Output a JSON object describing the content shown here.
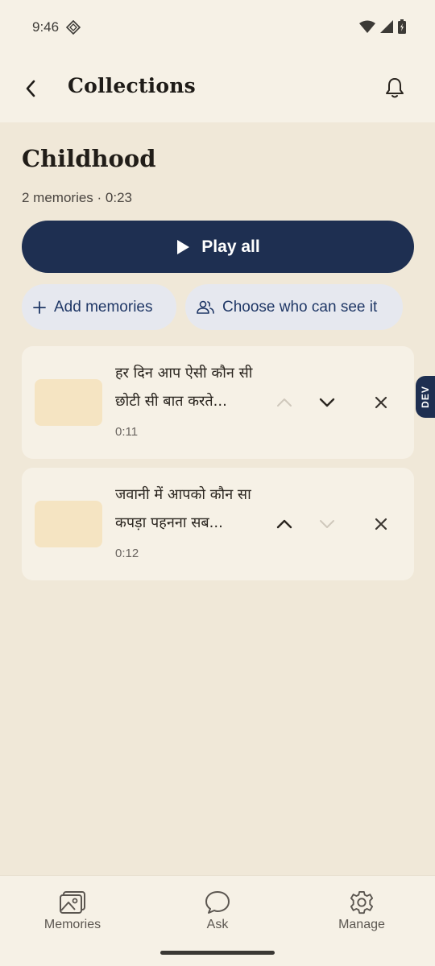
{
  "status_bar": {
    "time": "9:46"
  },
  "app_bar": {
    "title": "Collections"
  },
  "collection": {
    "title": "Childhood",
    "meta": "2 memories · 0:23",
    "play_all_label": "Play all",
    "add_memories_label": "Add memories",
    "choose_viewers_label": "Choose who can see it"
  },
  "memories": [
    {
      "text": "हर दिन आप ऐसी कौन सी छोटी सी बात करते...",
      "duration": "0:11"
    },
    {
      "text": "जवानी में आपको कौन सा कपड़ा पहनना सब...",
      "duration": "0:12"
    }
  ],
  "dev_badge": "DEV",
  "bottom_nav": {
    "memories": "Memories",
    "ask": "Ask",
    "manage": "Manage"
  },
  "colors": {
    "primary": "#1e2f51",
    "background": "#f0e8d8",
    "surface": "#f6f1e6",
    "chip": "#e6e8ef",
    "thumbnail": "#f5e4c2"
  }
}
